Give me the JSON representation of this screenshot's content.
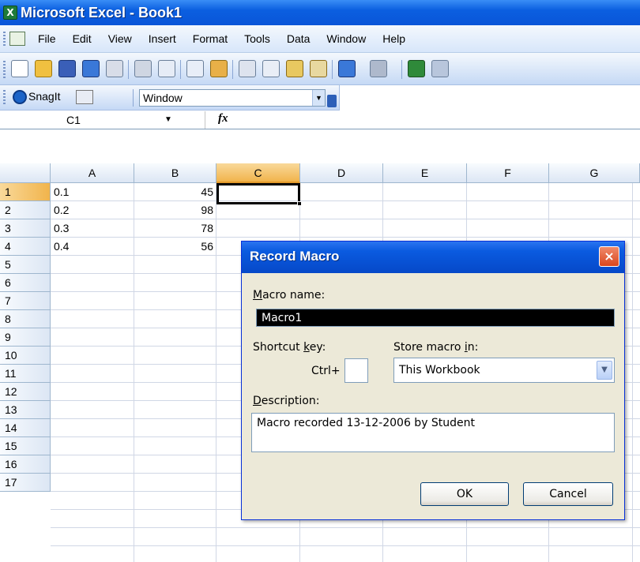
{
  "window": {
    "title": "Microsoft Excel - Book1"
  },
  "menu": [
    "File",
    "Edit",
    "View",
    "Insert",
    "Format",
    "Tools",
    "Data",
    "Window",
    "Help"
  ],
  "toolbar2": {
    "snagit_label": "SnagIt",
    "window_combo": "Window"
  },
  "formula_bar": {
    "name_box": "C1",
    "fx": "fx"
  },
  "sheet": {
    "columns": [
      "A",
      "B",
      "C",
      "D",
      "E",
      "F",
      "G"
    ],
    "rows": [
      "1",
      "2",
      "3",
      "4",
      "5",
      "6",
      "7",
      "8",
      "9",
      "10",
      "11",
      "12",
      "13",
      "14",
      "15",
      "16",
      "17"
    ],
    "col_a": [
      "0.1",
      "0.2",
      "0.3",
      "0.4"
    ],
    "col_b": [
      "45",
      "98",
      "78",
      "56"
    ]
  },
  "dialog": {
    "title": "Record Macro",
    "close": "×",
    "macro_name_label": "Macro name:",
    "macro_name_value": "Macro1",
    "shortcut_label": "Shortcut key:",
    "ctrl_label": "Ctrl+",
    "store_label": "Store macro in:",
    "store_value": "This Workbook",
    "description_label": "Description:",
    "description_value": "Macro recorded 13-12-2006 by Student",
    "ok": "OK",
    "cancel": "Cancel"
  }
}
